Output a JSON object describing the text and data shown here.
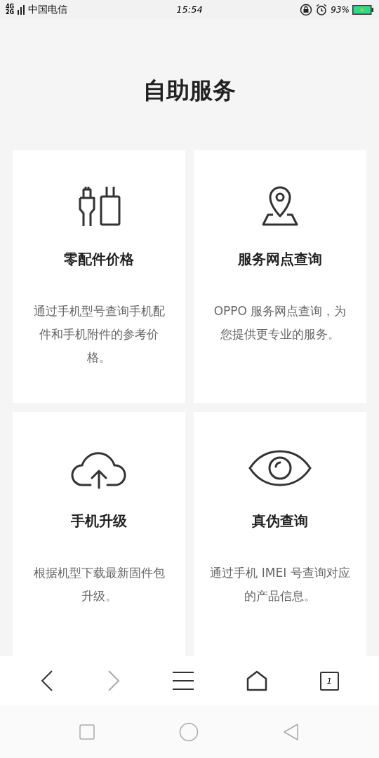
{
  "status_bar": {
    "network_top": "4G",
    "network_bottom": "2G",
    "carrier": "中国电信",
    "time": "15:54",
    "battery": "93%"
  },
  "title": "自助服务",
  "cards": [
    {
      "kind": "parts",
      "title": "零配件价格",
      "description": "通过手机型号查询手机配件和手机附件的参考价格。"
    },
    {
      "kind": "location",
      "title": "服务网点查询",
      "description": "OPPO 服务网点查询，为您提供更专业的服务。"
    },
    {
      "kind": "upgrade",
      "title": "手机升级",
      "description": "根据机型下载最新固件包升级。"
    },
    {
      "kind": "verify",
      "title": "真伪查询",
      "description": "通过手机 IMEI 号查询对应的产品信息。"
    }
  ],
  "toolbar": {
    "back_disabled": false,
    "forward_disabled": true,
    "tab_count": "1"
  }
}
